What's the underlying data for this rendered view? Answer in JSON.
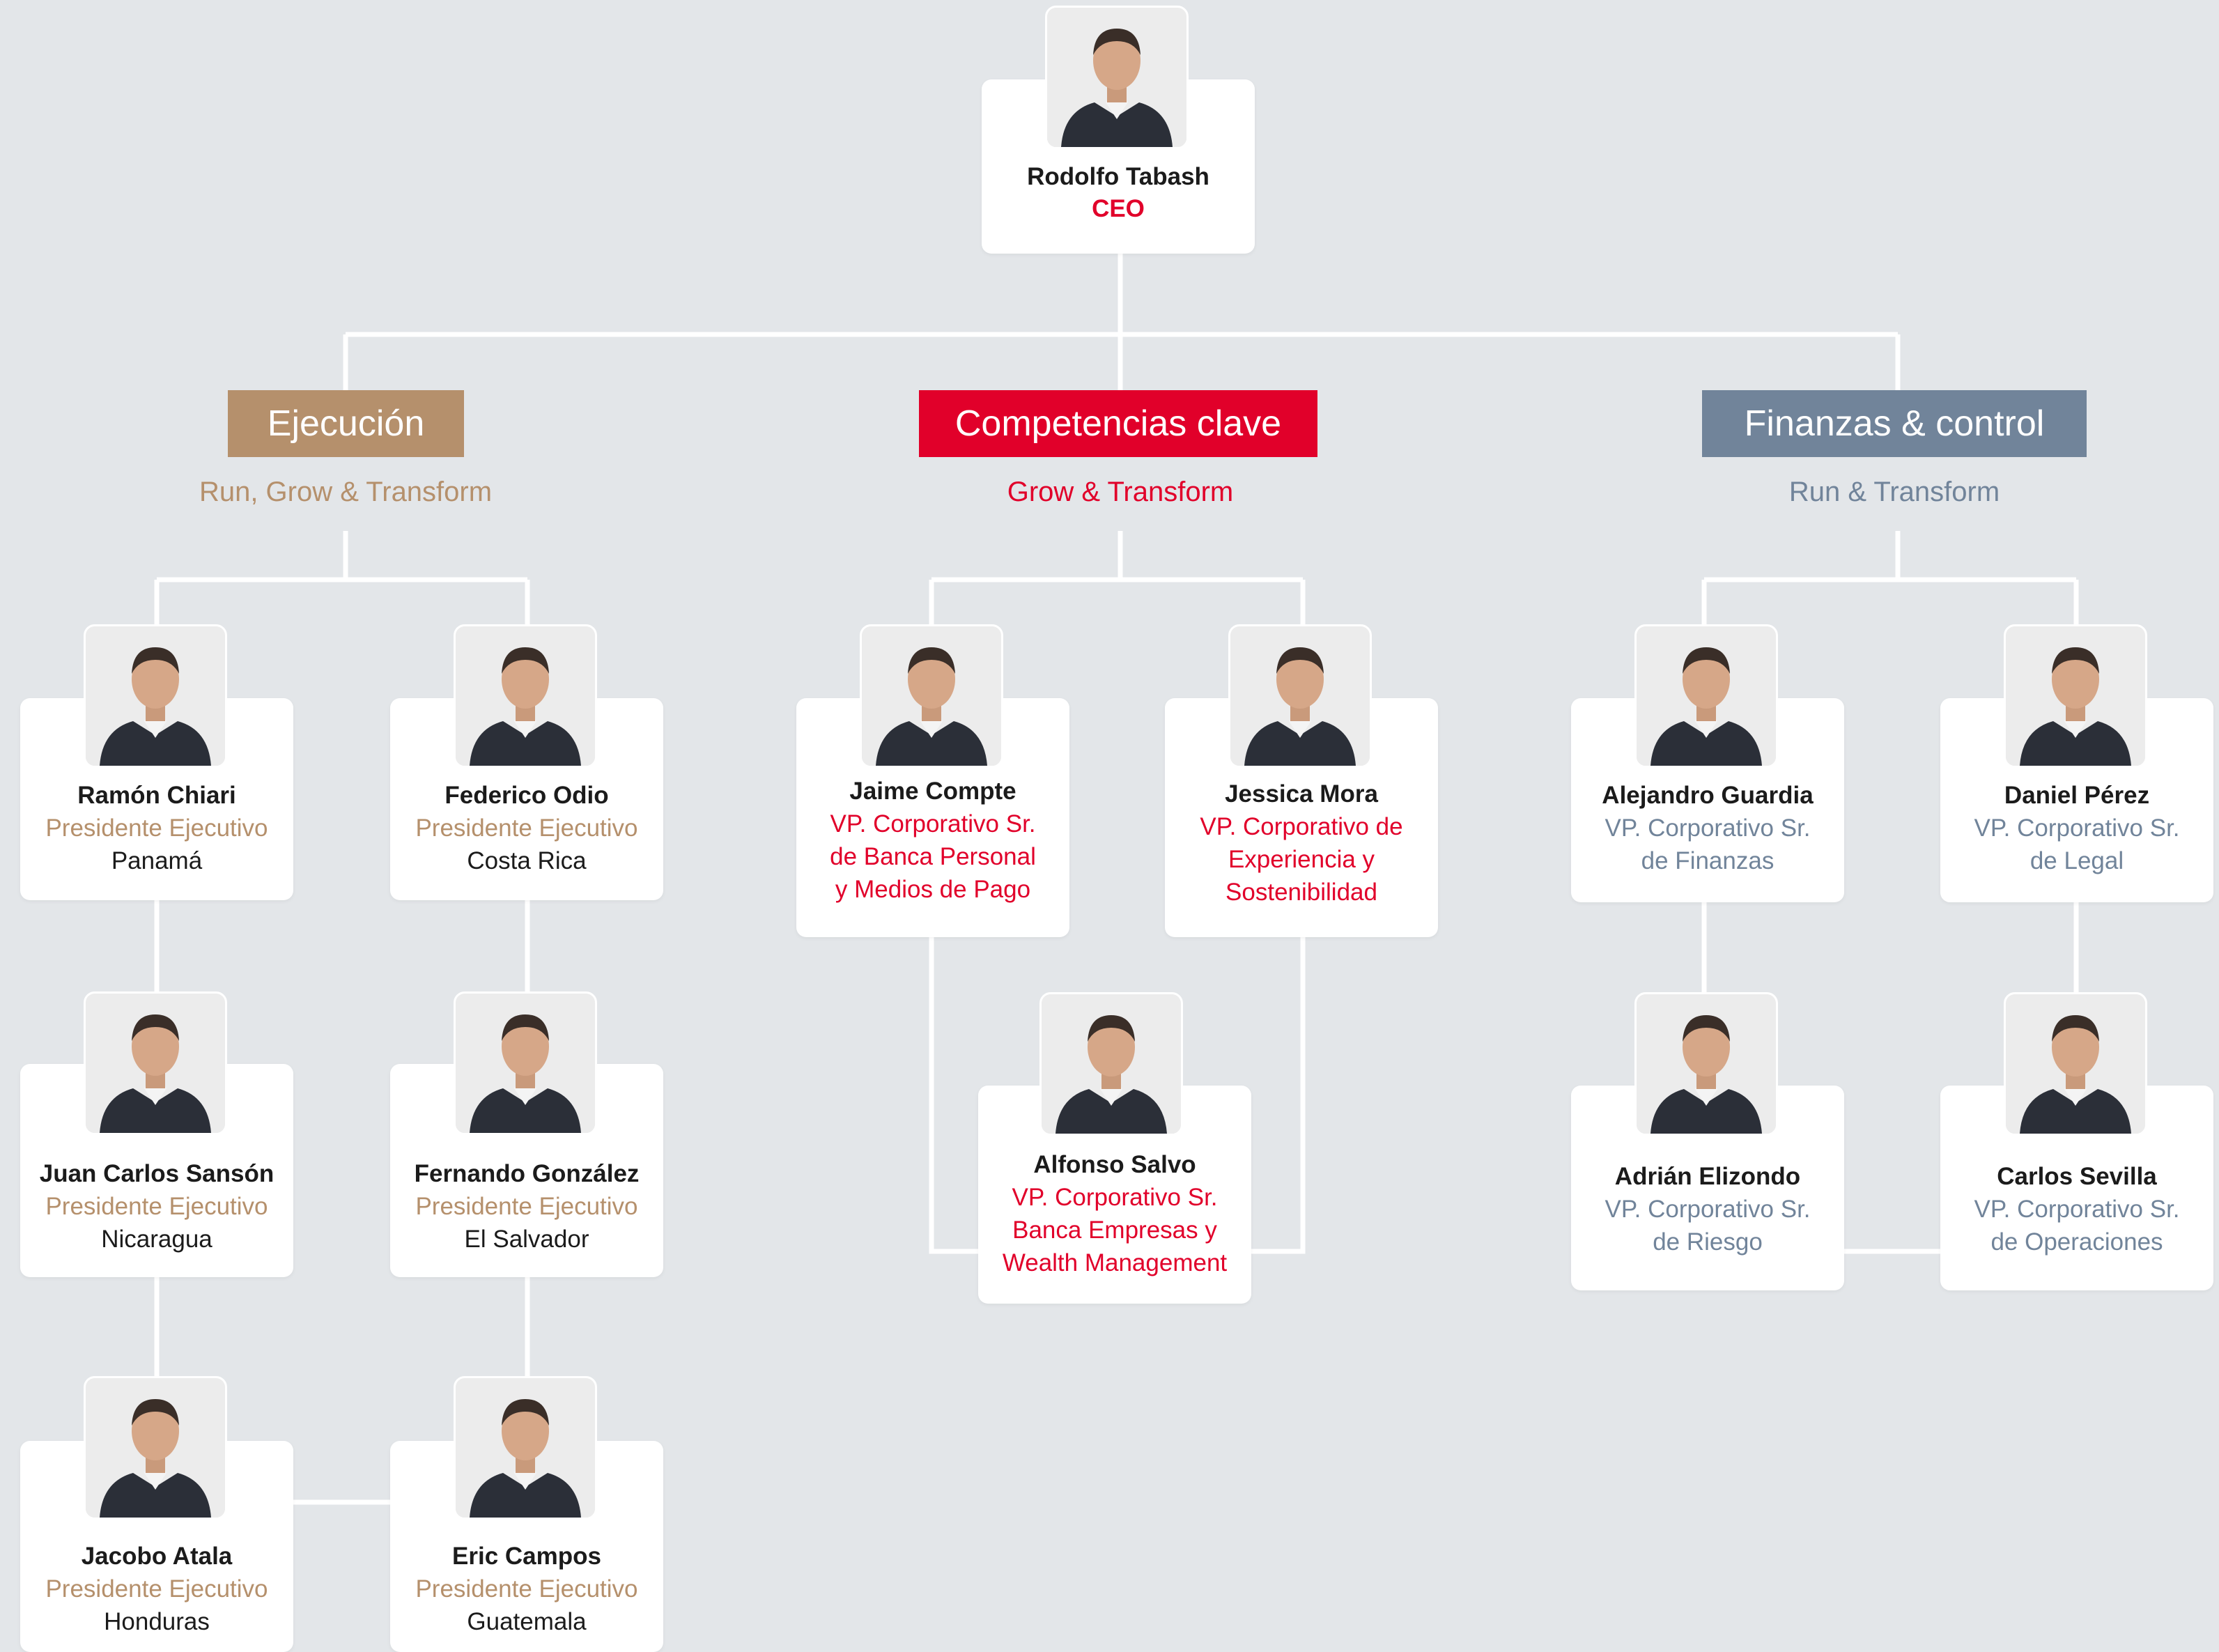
{
  "colors": {
    "background": "#e3e6e9",
    "connector": "#ffffff",
    "ejecucion": "#b5906c",
    "competencias": "#e1002a",
    "finanzas": "#71849a"
  },
  "ceo": {
    "name": "Rodolfo Tabash",
    "title": "CEO",
    "photo": "portrait-rodolfo-tabash"
  },
  "branches": {
    "ejecucion": {
      "header": "Ejecución",
      "tagline": "Run, Grow & Transform"
    },
    "competencias": {
      "header": "Competencias clave",
      "tagline": "Grow & Transform"
    },
    "finanzas": {
      "header": "Finanzas & control",
      "tagline": "Run & Transform"
    }
  },
  "people": {
    "ramon_chiari": {
      "name": "Ramón Chiari",
      "title": [
        "Presidente Ejecutivo"
      ],
      "country": "Panamá"
    },
    "federico_odio": {
      "name": "Federico Odio",
      "title": [
        "Presidente Ejecutivo"
      ],
      "country": "Costa Rica"
    },
    "juan_carlos_sanson": {
      "name": "Juan Carlos Sansón",
      "title": [
        "Presidente Ejecutivo"
      ],
      "country": "Nicaragua"
    },
    "fernando_gonzalez": {
      "name": "Fernando González",
      "title": [
        "Presidente Ejecutivo"
      ],
      "country": "El Salvador"
    },
    "jacobo_atala": {
      "name": "Jacobo Atala",
      "title": [
        "Presidente Ejecutivo"
      ],
      "country": "Honduras"
    },
    "eric_campos": {
      "name": "Eric Campos",
      "title": [
        "Presidente Ejecutivo"
      ],
      "country": "Guatemala"
    },
    "jaime_compte": {
      "name": "Jaime Compte",
      "title": [
        "VP. Corporativo Sr.",
        "de Banca Personal",
        "y Medios de Pago"
      ]
    },
    "jessica_mora": {
      "name": "Jessica Mora",
      "title": [
        "VP. Corporativo de",
        "Experiencia y",
        "Sostenibilidad"
      ]
    },
    "alfonso_salvo": {
      "name": "Alfonso Salvo",
      "title": [
        "VP. Corporativo Sr.",
        "Banca Empresas y",
        "Wealth Management"
      ]
    },
    "alejandro_guardia": {
      "name": "Alejandro Guardia",
      "title": [
        "VP. Corporativo Sr.",
        "de Finanzas"
      ]
    },
    "daniel_perez": {
      "name": "Daniel Pérez",
      "title": [
        "VP. Corporativo Sr.",
        "de Legal"
      ]
    },
    "adrian_elizondo": {
      "name": "Adrián Elizondo",
      "title": [
        "VP. Corporativo Sr.",
        "de Riesgo"
      ]
    },
    "carlos_sevilla": {
      "name": "Carlos Sevilla",
      "title": [
        "VP. Corporativo Sr.",
        "de Operaciones"
      ]
    }
  }
}
